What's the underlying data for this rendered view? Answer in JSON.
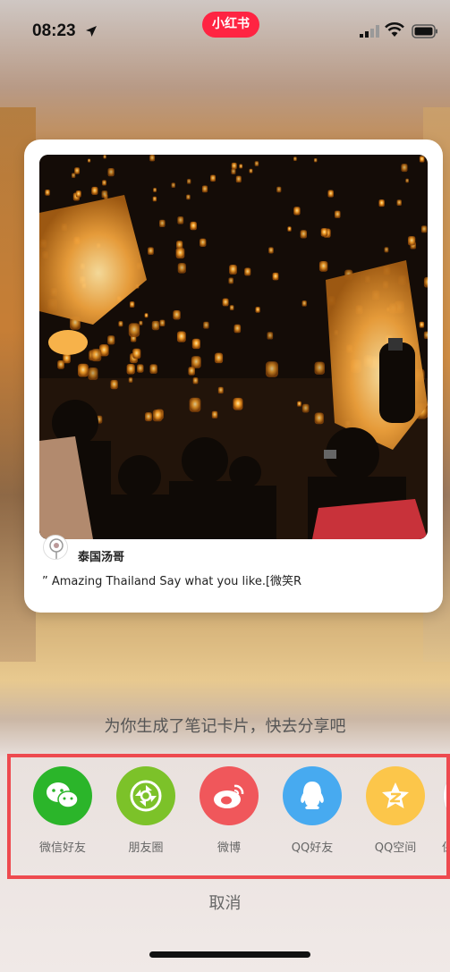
{
  "status_bar": {
    "time": "08:23",
    "app_badge": "小红书"
  },
  "card": {
    "author": "泰国汤哥",
    "caption": "” Amazing Thailand Say what you like.[微笑R"
  },
  "share_sheet": {
    "title": "为你生成了笔记卡片，快去分享吧",
    "items": [
      {
        "label": "微信好友",
        "icon": "wechat-icon",
        "color": "#2bb52a"
      },
      {
        "label": "朋友圈",
        "icon": "moments-icon",
        "color": "#7cc229"
      },
      {
        "label": "微博",
        "icon": "weibo-icon",
        "color": "#f0575b"
      },
      {
        "label": "QQ好友",
        "icon": "qq-icon",
        "color": "#47aaf0"
      },
      {
        "label": "QQ空间",
        "icon": "qzone-icon",
        "color": "#fcc64a"
      },
      {
        "label": "保",
        "icon": "save-icon",
        "color": "#ffffff"
      }
    ],
    "cancel": "取消"
  },
  "colors": {
    "brand": "#ff2442",
    "highlight_border": "#ee4a4f"
  }
}
